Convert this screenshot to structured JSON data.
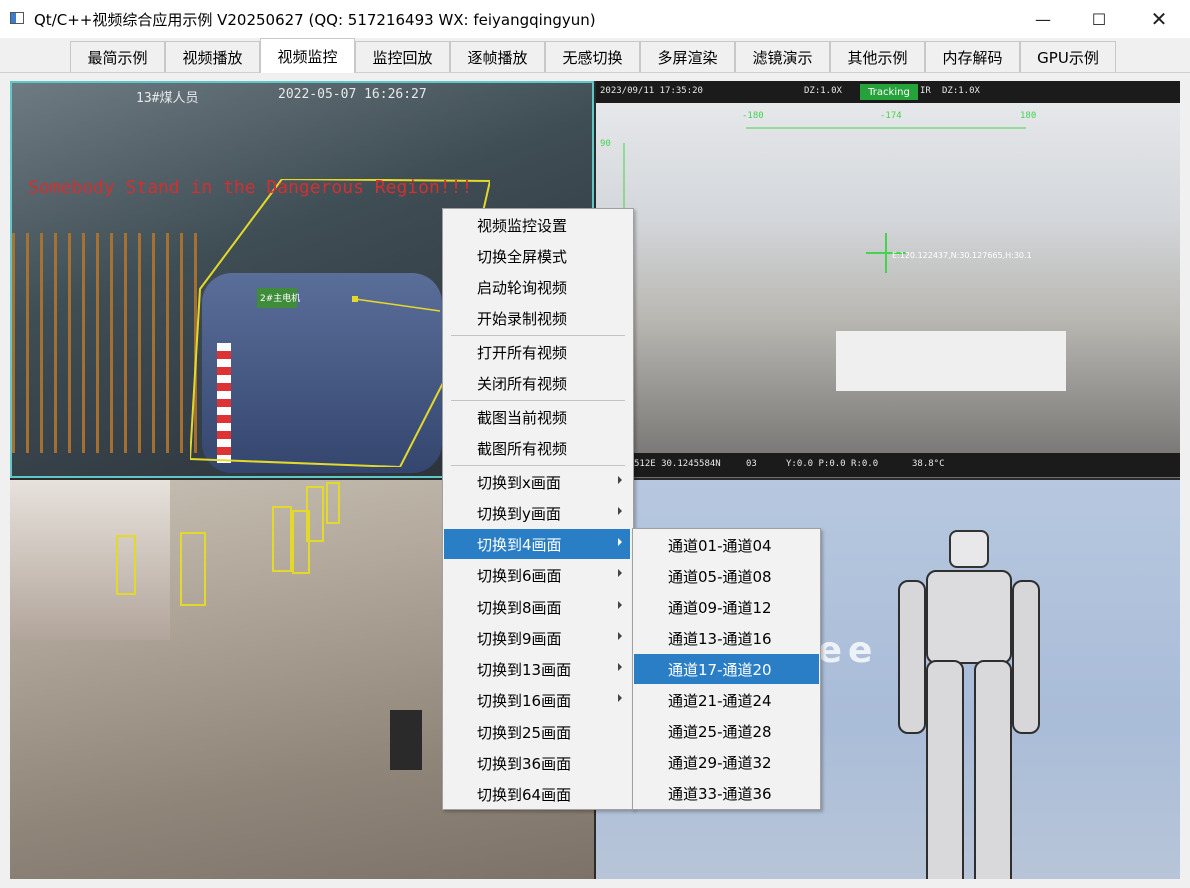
{
  "window": {
    "title": "Qt/C++视频综合应用示例 V20250627 (QQ: 517216493 WX: feiyangqingyun)",
    "minimize_glyph": "—",
    "maximize_glyph": "☐",
    "close_glyph": "✕"
  },
  "tabs": [
    {
      "label": "最简示例",
      "active": false
    },
    {
      "label": "视频播放",
      "active": false
    },
    {
      "label": "视频监控",
      "active": true
    },
    {
      "label": "监控回放",
      "active": false
    },
    {
      "label": "逐帧播放",
      "active": false
    },
    {
      "label": "无感切换",
      "active": false
    },
    {
      "label": "多屏渲染",
      "active": false
    },
    {
      "label": "滤镜演示",
      "active": false
    },
    {
      "label": "其他示例",
      "active": false
    },
    {
      "label": "内存解码",
      "active": false
    },
    {
      "label": "GPU示例",
      "active": false
    }
  ],
  "video": {
    "cell1": {
      "osd_name": "13#煤人员",
      "osd_time": "2022-05-07 16:26:27",
      "warning": "Somebody Stand in the Dangerous Region!!!",
      "plate": "2#主电机",
      "highlight_color": "#5fc7c7"
    },
    "cell2": {
      "datetime": "2023/09/11 17:35:20",
      "zoom_left": "DZ:1.0X",
      "tracking": "Tracking",
      "ir": "IR",
      "zoom_right": "DZ:1.0X",
      "gps_bottom": "512E 30.1245584N",
      "sats": "03",
      "pose": "Y:0.0 P:0.0 R:0.0",
      "temp": "38.8°C",
      "coords_overlay": "E:120.122437,N:30.127665,H:30.1",
      "hud_left": "90",
      "hud_mid_left": "-180",
      "hud_mid": "-174",
      "hud_right": "180"
    },
    "cell4": {
      "watermark": "nee"
    }
  },
  "context_menu": {
    "items": [
      {
        "label": "视频监控设置",
        "submenu": false
      },
      {
        "label": "切换全屏模式",
        "submenu": false
      },
      {
        "label": "启动轮询视频",
        "submenu": false
      },
      {
        "label": "开始录制视频",
        "submenu": false
      },
      {
        "label": "打开所有视频",
        "submenu": false
      },
      {
        "label": "关闭所有视频",
        "submenu": false
      },
      {
        "label": "截图当前视频",
        "submenu": false
      },
      {
        "label": "截图所有视频",
        "submenu": false
      },
      {
        "label": "切换到x画面",
        "submenu": true
      },
      {
        "label": "切换到y画面",
        "submenu": true
      },
      {
        "label": "切换到4画面",
        "submenu": true,
        "highlighted": true
      },
      {
        "label": "切换到6画面",
        "submenu": true
      },
      {
        "label": "切换到8画面",
        "submenu": true
      },
      {
        "label": "切换到9画面",
        "submenu": true
      },
      {
        "label": "切换到13画面",
        "submenu": true
      },
      {
        "label": "切换到16画面",
        "submenu": true
      },
      {
        "label": "切换到25画面",
        "submenu": false
      },
      {
        "label": "切换到36画面",
        "submenu": false
      },
      {
        "label": "切换到64画面",
        "submenu": false
      }
    ],
    "highlight_color": "#2a7ec6"
  },
  "submenu": {
    "items": [
      {
        "label": "通道01-通道04"
      },
      {
        "label": "通道05-通道08"
      },
      {
        "label": "通道09-通道12"
      },
      {
        "label": "通道13-通道16"
      },
      {
        "label": "通道17-通道20",
        "highlighted": true
      },
      {
        "label": "通道21-通道24"
      },
      {
        "label": "通道25-通道28"
      },
      {
        "label": "通道29-通道32"
      },
      {
        "label": "通道33-通道36"
      }
    ]
  }
}
